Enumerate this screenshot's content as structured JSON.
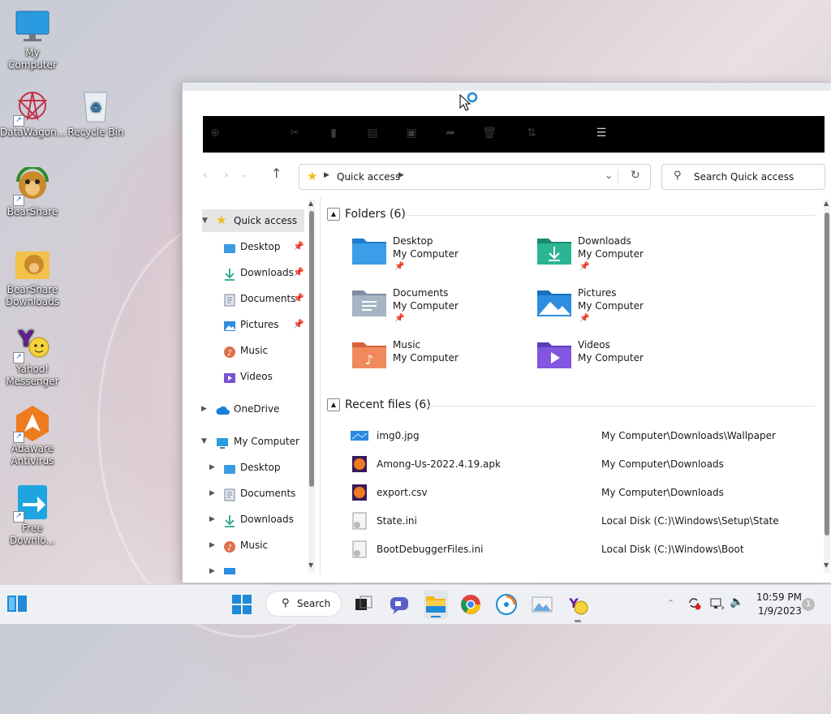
{
  "desktop": {
    "icons": [
      {
        "label": "My Computer"
      },
      {
        "label": "DataWagon..."
      },
      {
        "label": "Recycle Bin"
      },
      {
        "label": "BearShare"
      },
      {
        "label": "BearShare Downloads"
      },
      {
        "label": "Yahoo! Messenger"
      },
      {
        "label": "Adaware Antivirus"
      },
      {
        "label": "Free Downlo..."
      }
    ]
  },
  "explorer": {
    "address": {
      "location": "Quick access"
    },
    "search": {
      "placeholder": "Search Quick access"
    },
    "nav": {
      "quick_access": "Quick access",
      "items": [
        {
          "label": "Desktop"
        },
        {
          "label": "Downloads"
        },
        {
          "label": "Documents"
        },
        {
          "label": "Pictures"
        },
        {
          "label": "Music"
        },
        {
          "label": "Videos"
        }
      ],
      "onedrive": "OneDrive",
      "my_computer": "My Computer",
      "pc_items": [
        {
          "label": "Desktop"
        },
        {
          "label": "Documents"
        },
        {
          "label": "Downloads"
        },
        {
          "label": "Music"
        }
      ]
    },
    "folders_header": "Folders (6)",
    "folders": [
      {
        "name": "Desktop",
        "location": "My Computer"
      },
      {
        "name": "Downloads",
        "location": "My Computer"
      },
      {
        "name": "Documents",
        "location": "My Computer"
      },
      {
        "name": "Pictures",
        "location": "My Computer"
      },
      {
        "name": "Music",
        "location": "My Computer"
      },
      {
        "name": "Videos",
        "location": "My Computer"
      }
    ],
    "recent_header": "Recent files (6)",
    "recent_files": [
      {
        "name": "img0.jpg",
        "path": "My Computer\\Downloads\\Wallpaper"
      },
      {
        "name": "Among-Us-2022.4.19.apk",
        "path": "My Computer\\Downloads"
      },
      {
        "name": "export.csv",
        "path": "My Computer\\Downloads"
      },
      {
        "name": "State.ini",
        "path": "Local Disk (C:)\\Windows\\Setup\\State"
      },
      {
        "name": "BootDebuggerFiles.ini",
        "path": "Local Disk (C:)\\Windows\\Boot"
      }
    ]
  },
  "taskbar": {
    "search_label": "Search",
    "time": "10:59 PM",
    "date": "1/9/2023",
    "notification_count": "1"
  },
  "colors": {
    "accent": "#0067c0",
    "folder_blue": "#3a8fd8",
    "folder_green": "#27a58a"
  }
}
